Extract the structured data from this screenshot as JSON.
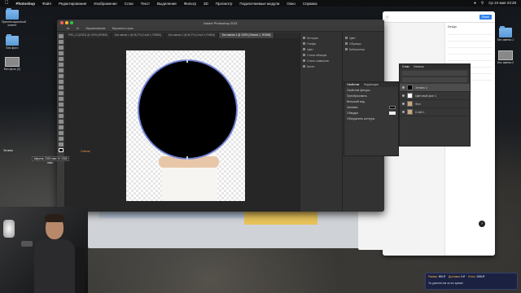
{
  "menubar": {
    "app": "Photoshop",
    "items": [
      "Файл",
      "Редактирование",
      "Изображение",
      "Слои",
      "Текст",
      "Выделение",
      "Фильтр",
      "3D",
      "Просмотр",
      "Подключаемые модули",
      "Окно",
      "Справка"
    ],
    "clock": "Ср 24 мая 23:28"
  },
  "desktop": {
    "icons": [
      {
        "label": "Пресентационный клиент"
      },
      {
        "label": "Без фото"
      },
      {
        "label": "Без фото (2)"
      },
      {
        "label": "Без имени-1"
      },
      {
        "label": "Без имени-2"
      }
    ]
  },
  "photoshop": {
    "title": "Adobe Photoshop 2021",
    "options": [
      "Ш:",
      "В:",
      "Выравнивание",
      "Выровнять края"
    ],
    "tabs": [
      {
        "label": "PSD_3-2(2023) @ 100% (RGB/8)",
        "active": false
      },
      {
        "label": "Без имени-1 @ 66,7% (Слой 4, RGB/8)",
        "active": false
      },
      {
        "label": "Без имени-1 @ 66,7% (Слой 4, RGB/8)",
        "active": false
      },
      {
        "label": "Без имени-1 @ 100% (Эллипс 1, RGB/8)",
        "active": true
      }
    ],
    "right_panel_a": [
      "История",
      "Глифы",
      "Цвет",
      "Стили абзацев",
      "Стили символов",
      "Кисти"
    ],
    "right_panel_b": [
      "Цвет",
      "Образцы",
      "Библиотеки"
    ]
  },
  "status": {
    "left_label": "Эллипс",
    "tooltip": "Ширина: 2326 пикс. В: 2326 пикс.",
    "orange_label": "Отмена"
  },
  "properties": {
    "tabs": [
      "Свойства",
      "Коррекция"
    ],
    "rows": [
      "Свойства фигуры",
      "Преобразовать",
      "Внешний вид",
      "Заливка",
      "Обводка",
      "Объединить контуры"
    ]
  },
  "layers": {
    "tabs": [
      "Слои",
      "Каналы"
    ],
    "rows": [
      {
        "name": "Эллипс 1",
        "thumb": "black",
        "selected": true
      },
      {
        "name": "Цветовой фон 1",
        "thumb": "white",
        "selected": false
      },
      {
        "name": "Фон",
        "thumb": "photo",
        "selected": false
      },
      {
        "name": "Слой 1",
        "thumb": "photo",
        "selected": false
      }
    ]
  },
  "figma": {
    "button": "Share",
    "side_title": "Design"
  },
  "prop_side": [
    "Auto Layout",
    "Fill",
    "Stroke"
  ],
  "notification": {
    "items": [
      {
        "k": "Размер:",
        "v": "900 ₽"
      },
      {
        "k": "Доставка:",
        "v": "0 ₽"
      },
      {
        "k": "Итого:",
        "v": "1900 ₽"
      }
    ],
    "footer": "Ты доволен им за это время!"
  },
  "colors": {
    "accent": "#2f80ed",
    "selection": "#7b8be0",
    "orange": "#e39a45"
  }
}
